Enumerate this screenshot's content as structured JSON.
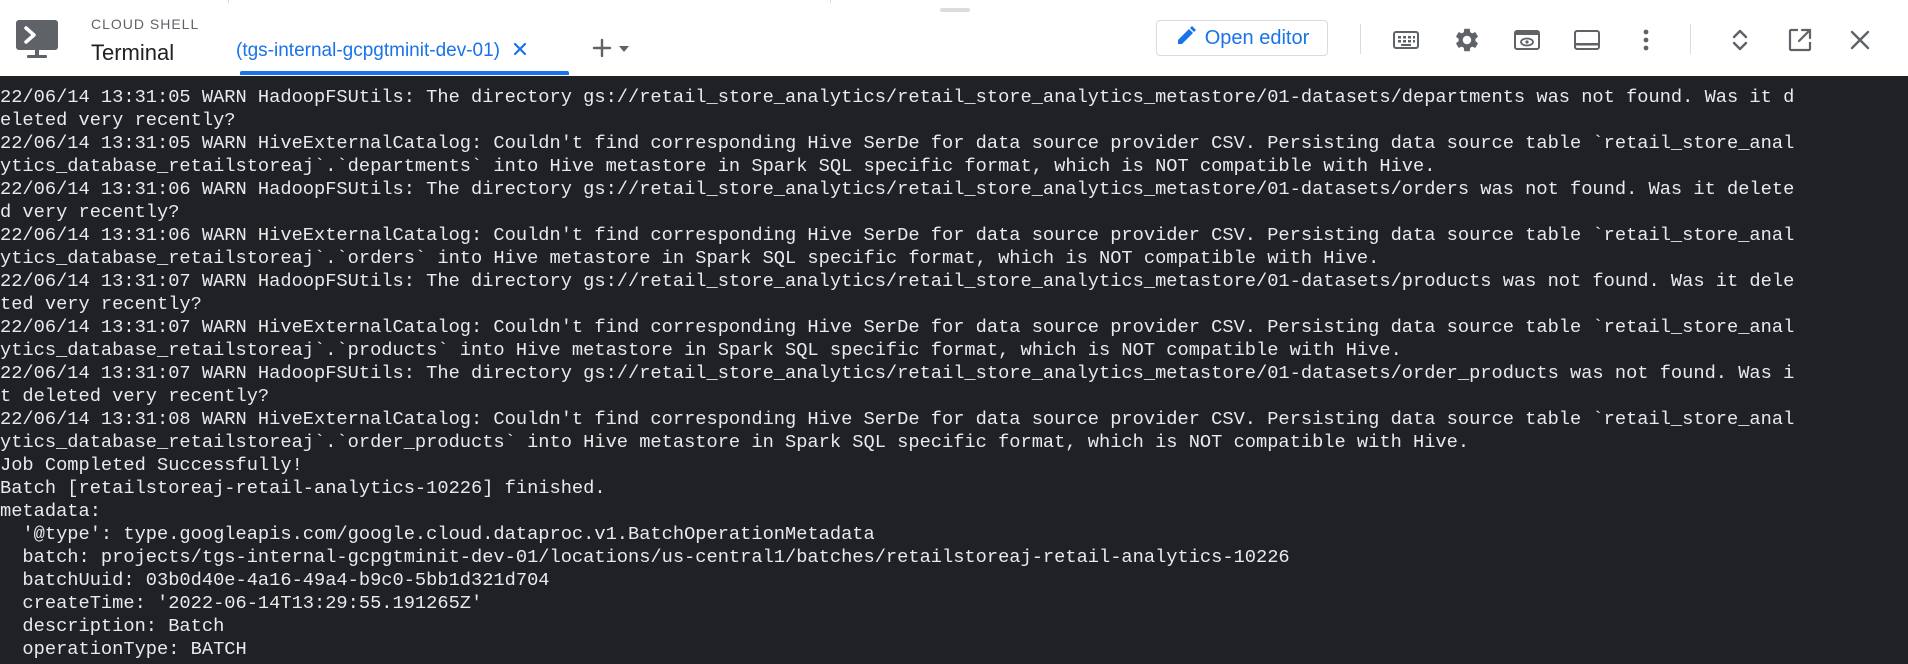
{
  "header": {
    "product_small": "CLOUD SHELL",
    "product_title": "Terminal",
    "tab_label": "(tgs-internal-gcpgtminit-dev-01)",
    "open_editor_label": "Open editor"
  },
  "icons": {
    "cloud_shell": "terminal-monitor-icon",
    "tab_close": "close-icon",
    "add_tab": "plus-icon",
    "add_tab_menu": "caret-down-icon",
    "open_editor": "pencil-icon",
    "keyboard": "keyboard-icon",
    "settings": "gear-icon",
    "web_preview": "web-preview-icon",
    "layout": "panel-layout-icon",
    "more": "more-vert-icon",
    "maximize": "unfold-icon",
    "new_window": "open-in-new-icon",
    "close": "close-icon"
  },
  "colors": {
    "accent": "#1a73e8",
    "terminal_bg": "#202124",
    "terminal_fg": "#e8eaed",
    "icon": "#5f6368"
  },
  "terminal": {
    "lines": [
      "22/06/14 13:31:05 WARN HadoopFSUtils: The directory gs://retail_store_analytics/retail_store_analytics_metastore/01-datasets/departments was not found. Was it d",
      "eleted very recently?",
      "22/06/14 13:31:05 WARN HiveExternalCatalog: Couldn't find corresponding Hive SerDe for data source provider CSV. Persisting data source table `retail_store_anal",
      "ytics_database_retailstoreaj`.`departments` into Hive metastore in Spark SQL specific format, which is NOT compatible with Hive.",
      "22/06/14 13:31:06 WARN HadoopFSUtils: The directory gs://retail_store_analytics/retail_store_analytics_metastore/01-datasets/orders was not found. Was it delete",
      "d very recently?",
      "22/06/14 13:31:06 WARN HiveExternalCatalog: Couldn't find corresponding Hive SerDe for data source provider CSV. Persisting data source table `retail_store_anal",
      "ytics_database_retailstoreaj`.`orders` into Hive metastore in Spark SQL specific format, which is NOT compatible with Hive.",
      "22/06/14 13:31:07 WARN HadoopFSUtils: The directory gs://retail_store_analytics/retail_store_analytics_metastore/01-datasets/products was not found. Was it dele",
      "ted very recently?",
      "22/06/14 13:31:07 WARN HiveExternalCatalog: Couldn't find corresponding Hive SerDe for data source provider CSV. Persisting data source table `retail_store_anal",
      "ytics_database_retailstoreaj`.`products` into Hive metastore in Spark SQL specific format, which is NOT compatible with Hive.",
      "22/06/14 13:31:07 WARN HadoopFSUtils: The directory gs://retail_store_analytics/retail_store_analytics_metastore/01-datasets/order_products was not found. Was i",
      "t deleted very recently?",
      "22/06/14 13:31:08 WARN HiveExternalCatalog: Couldn't find corresponding Hive SerDe for data source provider CSV. Persisting data source table `retail_store_anal",
      "ytics_database_retailstoreaj`.`order_products` into Hive metastore in Spark SQL specific format, which is NOT compatible with Hive.",
      "Job Completed Successfully!",
      "Batch [retailstoreaj-retail-analytics-10226] finished.",
      "metadata:",
      "  '@type': type.googleapis.com/google.cloud.dataproc.v1.BatchOperationMetadata",
      "  batch: projects/tgs-internal-gcpgtminit-dev-01/locations/us-central1/batches/retailstoreaj-retail-analytics-10226",
      "  batchUuid: 03b0d40e-4a16-49a4-b9c0-5bb1d321d704",
      "  createTime: '2022-06-14T13:29:55.191265Z'",
      "  description: Batch",
      "  operationType: BATCH"
    ]
  }
}
